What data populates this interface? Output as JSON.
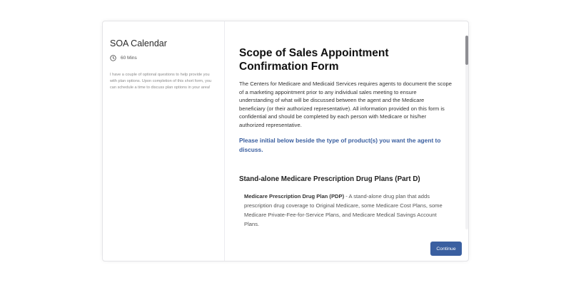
{
  "sidebar": {
    "title": "SOA Calendar",
    "duration": "60 Mins",
    "description": "I have a couple of optional questions to help provide you with plan options. Upon completion of this short form, you can schedule a time to discuss plan options in your area!"
  },
  "form": {
    "title": "Scope of Sales Appointment Confirmation Form",
    "intro": "The Centers for Medicare and Medicaid Services requires agents to document the scope of a marketing appointment prior to any individual sales meeting to ensure understanding of what will be discussed between the agent and the Medicare beneficiary (or their authorized representative). All information provided on this form is confidential and should be completed by each person with Medicare or his/her authorized representative.",
    "instruction": "Please initial below beside the type of product(s) you want the agent to discuss.",
    "sections": [
      {
        "heading": "Stand-alone Medicare Prescription Drug Plans (Part D)",
        "plan_name": "Medicare Prescription Drug Plan (PDP)",
        "plan_text": " - A stand-alone drug plan that adds prescription drug coverage to Original Medicare, some Medicare Cost Plans, some Medicare Private-Fee-for-Service Plans, and Medicare Medical Savings Account Plans."
      }
    ]
  },
  "actions": {
    "continue_label": "Continue"
  },
  "scrollbar": {
    "scroll_fraction": 0.0
  },
  "icons": {
    "duration": "clock-icon"
  },
  "colors": {
    "accent": "#3a5fa0",
    "button_text": "#ffffff"
  }
}
